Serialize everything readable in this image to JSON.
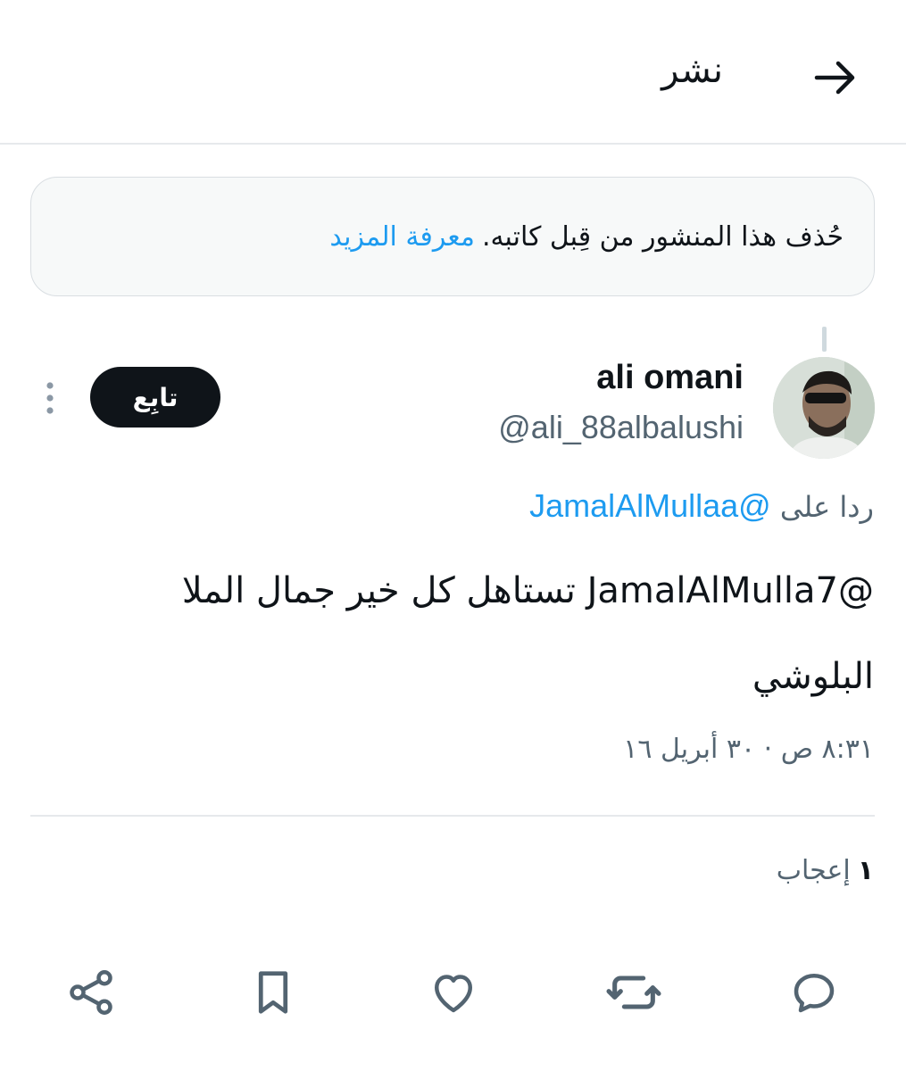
{
  "header": {
    "title": "نشر",
    "back_icon": "arrow-right-icon"
  },
  "notice": {
    "text": "حُذف هذا المنشور من قِبل كاتبه.",
    "link": "معرفة المزيد"
  },
  "author": {
    "display_name": "ali omani",
    "handle": "@ali_88albalushi",
    "follow_label": "تابِع"
  },
  "tweet": {
    "reply_prefix": "ردا على",
    "reply_mention": "@JamalAlMullaa",
    "text": "@JamalAlMulla7 تستاهل كل خير جمال الملا البلوشي",
    "timestamp": "٨:٣١ ص · ٣٠ أبريل ١٦"
  },
  "stats": {
    "likes_count": "١",
    "likes_label": "إعجاب"
  },
  "actions": [
    {
      "name": "reply",
      "icon": "comment-icon"
    },
    {
      "name": "repost",
      "icon": "repost-icon"
    },
    {
      "name": "like",
      "icon": "heart-icon"
    },
    {
      "name": "bookmark",
      "icon": "bookmark-icon"
    },
    {
      "name": "share",
      "icon": "share-icon"
    }
  ],
  "colors": {
    "accent": "#1d9bf0",
    "text_primary": "#0f1419",
    "text_secondary": "#536471",
    "icon": "#536471",
    "border": "#e6e9ec"
  }
}
